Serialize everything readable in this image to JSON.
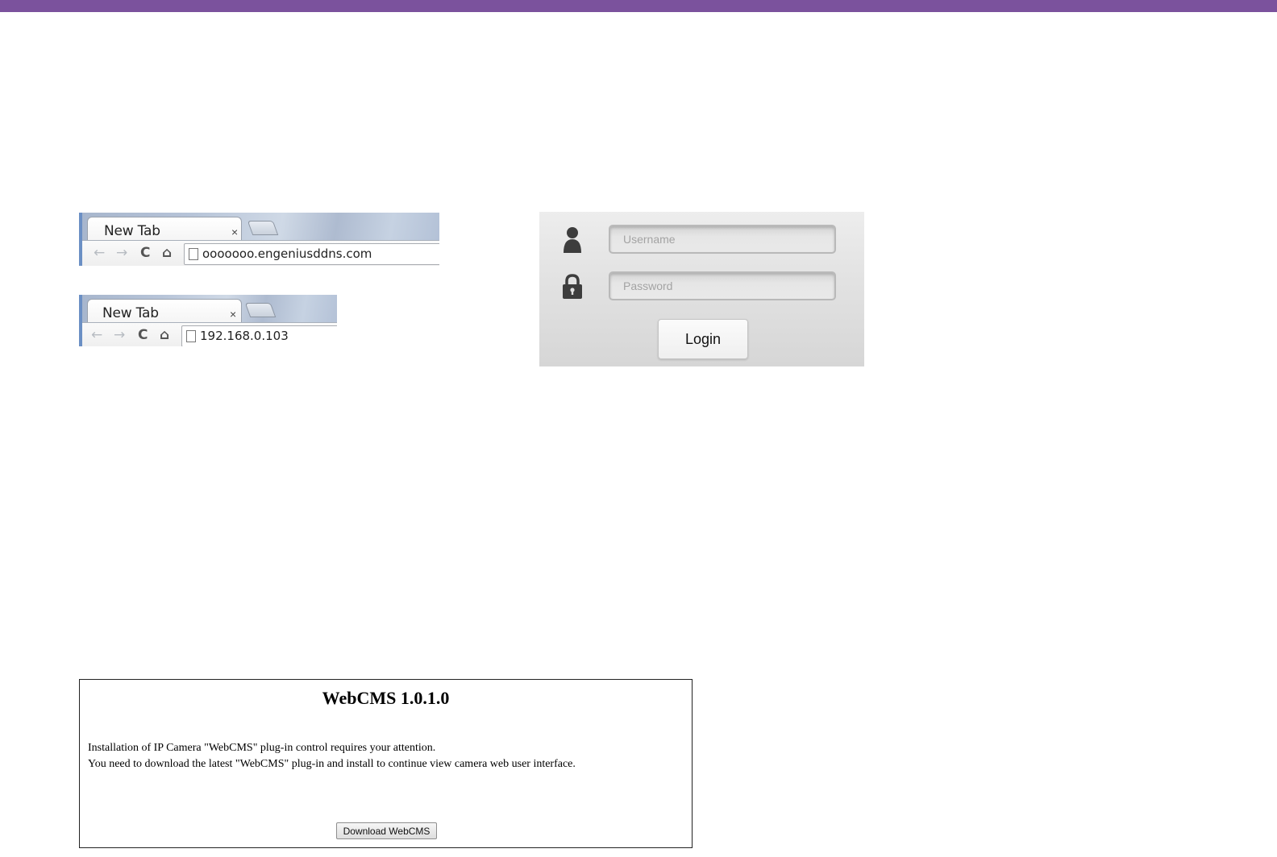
{
  "browsers": [
    {
      "tab_title": "New Tab",
      "tab_close": "×",
      "url": "ooooooo.engeniusddns.com"
    },
    {
      "tab_title": "New Tab",
      "tab_close": "×",
      "url": "192.168.0.103"
    }
  ],
  "nav_icons": {
    "back": "←",
    "forward": "→",
    "reload": "C",
    "home": "⌂"
  },
  "login": {
    "username_placeholder": "Username",
    "password_placeholder": "Password",
    "login_label": "Login"
  },
  "webcms": {
    "title": "WebCMS 1.0.1.0",
    "line1": "Installation of IP Camera \"WebCMS\" plug-in control requires your attention.",
    "line2": "You need to download the latest \"WebCMS\" plug-in and install to continue view camera web user interface.",
    "download_label": "Download WebCMS"
  },
  "colors": {
    "accent_bar": "#7b529d"
  }
}
